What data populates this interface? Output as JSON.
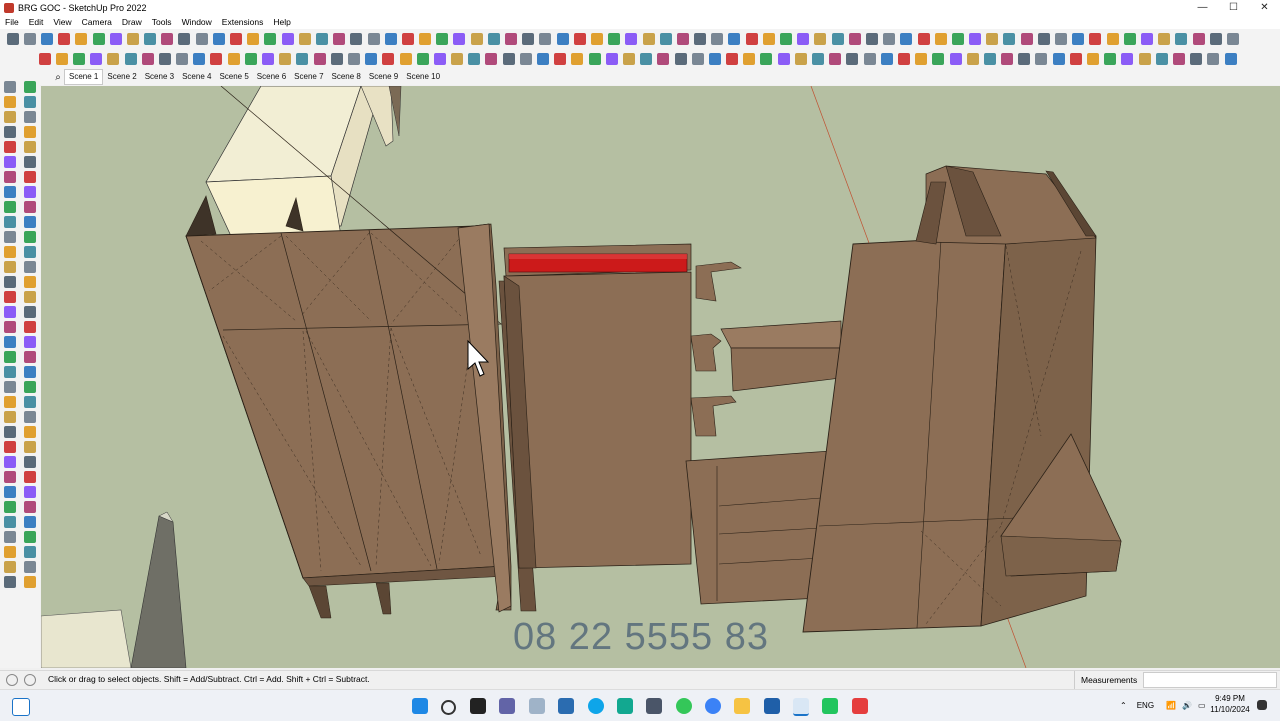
{
  "window": {
    "title": "BRG GOC - SketchUp Pro 2022",
    "minimize_glyph": "—",
    "maximize_glyph": "☐",
    "close_glyph": "✕"
  },
  "menu": {
    "items": [
      "File",
      "Edit",
      "View",
      "Camera",
      "Draw",
      "Tools",
      "Window",
      "Extensions",
      "Help"
    ]
  },
  "scenes": {
    "search_glyph": "⌕",
    "tabs": [
      "Scene 1",
      "Scene 2",
      "Scene 3",
      "Scene 4",
      "Scene 5",
      "Scene 6",
      "Scene 7",
      "Scene 8",
      "Scene 9",
      "Scene 10"
    ],
    "active": "Scene 1"
  },
  "viewport": {
    "watermark": "08 22 5555 83",
    "background_color": "#b5bfa2",
    "wood_color": "#8c6e55",
    "highlight_color": "#cc1a1a"
  },
  "status": {
    "message": "Click or drag to select objects. Shift = Add/Subtract. Ctrl = Add. Shift + Ctrl = Subtract.",
    "measurements_label": "Measurements",
    "measurements_value": ""
  },
  "taskbar": {
    "language": "ENG",
    "time": "9:49 PM",
    "date": "11/10/2024"
  },
  "toolbar_icons": [
    "orbit-icon",
    "pan-icon",
    "zoom-icon",
    "zoom-extents-icon",
    "select-icon",
    "eraser-icon",
    "paint-bucket-icon",
    "line-icon",
    "rectangle-icon",
    "push-pull-icon",
    "move-icon",
    "rotate-icon",
    "scale-icon",
    "offset-icon",
    "tape-measure-icon",
    "text-icon",
    "section-plane-icon",
    "component-icon",
    "group-icon",
    "layer-icon"
  ]
}
